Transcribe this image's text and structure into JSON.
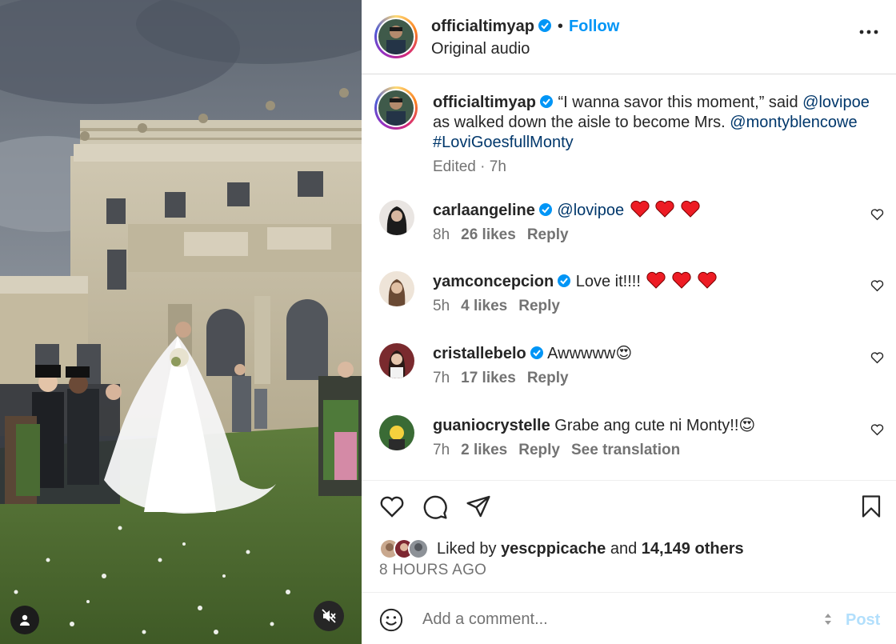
{
  "post": {
    "username": "officialtimyap",
    "follow_label": "Follow",
    "dot": "•",
    "audio": "Original audio"
  },
  "caption": {
    "username": "officialtimyap",
    "part1": " “I wanna savor this moment,” said ",
    "mention1": "@lovipoe",
    "part2": " as walked down the aisle to become Mrs. ",
    "mention2": "@montyblencowe",
    "space": " ",
    "hashtag": "#LoviGoesfullMonty",
    "edited": "Edited · 7h"
  },
  "comments": [
    {
      "username": "carlaangeline",
      "verified": true,
      "text": "@lovipoe",
      "hearts": 3,
      "time": "8h",
      "likes": "26 likes",
      "reply": "Reply"
    },
    {
      "username": "yamconcepcion",
      "verified": true,
      "text": "Love it!!!!",
      "hearts": 3,
      "time": "5h",
      "likes": "4 likes",
      "reply": "Reply"
    },
    {
      "username": "cristallebelo",
      "verified": true,
      "text": "Awwwww",
      "emoji": "😍",
      "time": "7h",
      "likes": "17 likes",
      "reply": "Reply"
    },
    {
      "username": "guaniocrystelle",
      "verified": false,
      "text": "Grabe ang cute ni Monty!!",
      "emoji": "😍",
      "time": "7h",
      "likes": "2 likes",
      "reply": "Reply",
      "translate": "See translation"
    }
  ],
  "likes": {
    "prefix": "Liked by ",
    "user": "yescppicache",
    "middle": " and ",
    "count": "14,149 others"
  },
  "timestamp": "8 HOURS AGO",
  "comment_box": {
    "placeholder": "Add a comment...",
    "post_label": "Post"
  },
  "colors": {
    "accent": "#0095f6",
    "link": "#00376b",
    "like_red": "#ed1c24",
    "muted": "#737373"
  }
}
